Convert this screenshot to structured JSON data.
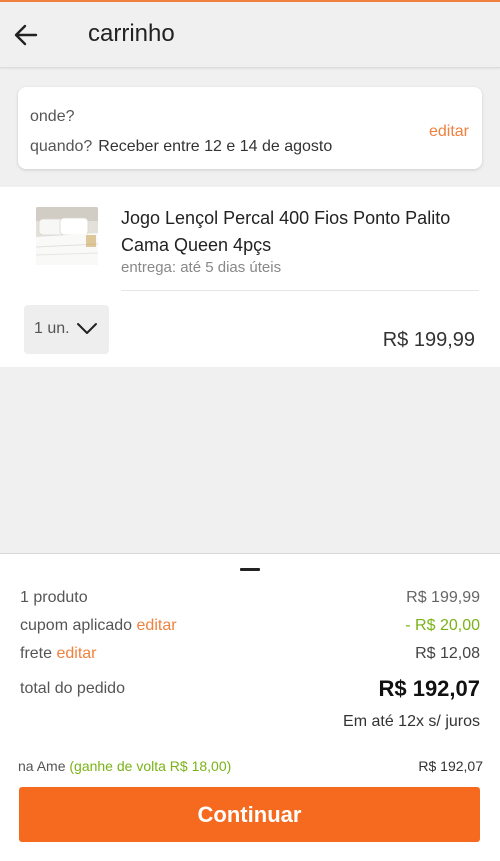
{
  "header": {
    "title": "carrinho",
    "back_icon": "arrow-left-icon"
  },
  "delivery": {
    "where_label": "onde?",
    "when_label": "quando?",
    "when_value": "Receber entre 12 e 14 de agosto",
    "edit_label": "editar"
  },
  "product": {
    "name": "Jogo Lençol Percal 400 Fios Ponto Palito Cama Queen 4pçs",
    "delivery": "entrega: até 5 dias úteis",
    "quantity": "1 un.",
    "price": "R$ 199,99"
  },
  "summary": {
    "products_label": "1 produto",
    "products_value": "R$ 199,99",
    "coupon_label": "cupom aplicado",
    "coupon_edit": "editar",
    "coupon_value": "- R$ 20,00",
    "shipping_label": "frete",
    "shipping_edit": "editar",
    "shipping_value": "R$ 12,08",
    "total_label": "total do pedido",
    "total_value": "R$ 192,07",
    "installments": "Em até 12x s/ juros",
    "ame_label": "na Ame",
    "ame_cashback": "(ganhe de volta R$ 18,00)",
    "ame_value": "R$ 192,07",
    "continue_label": "Continuar"
  },
  "colors": {
    "accent": "#f0813f",
    "button": "#f56a1f",
    "positive": "#7ab317"
  }
}
